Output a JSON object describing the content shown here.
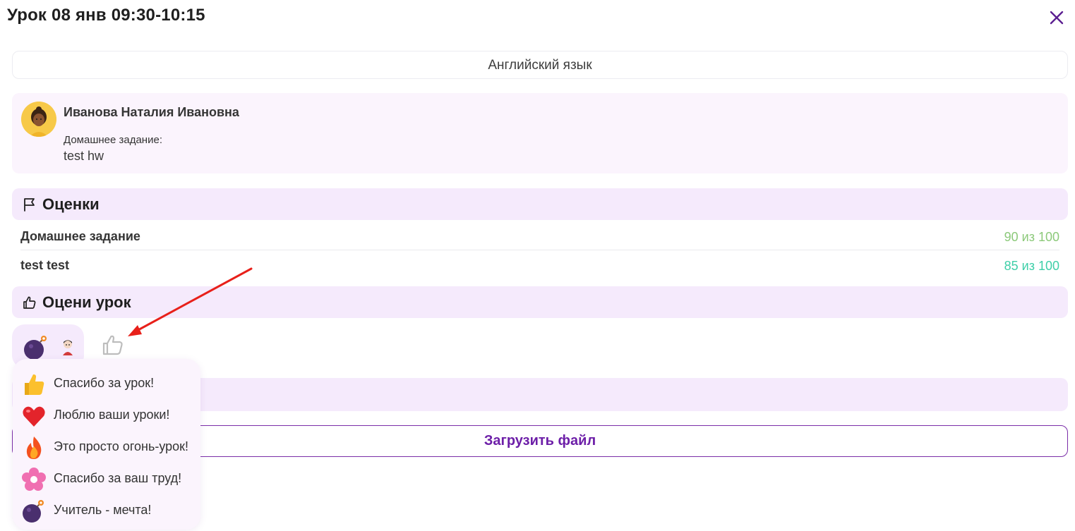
{
  "header": {
    "title": "Урок 08 янв 09:30-10:15",
    "close_icon": "close-icon"
  },
  "subject": "Английский язык",
  "teacher": {
    "name": "Иванова Наталия Ивановна",
    "homework_label": "Домашнее задание:",
    "homework_text": "test hw"
  },
  "grades_section": {
    "title": "Оценки",
    "icon": "flag-icon",
    "items": [
      {
        "name": "Домашнее задание",
        "value": "90 из 100",
        "color": "#8cc97a"
      },
      {
        "name": "test test",
        "value": "85 из 100",
        "color": "#3ecfa8"
      }
    ]
  },
  "rate_section": {
    "title": "Оцени урок",
    "icon": "thumbs-up-icon"
  },
  "reactions_popup": {
    "items": [
      {
        "label": "Спасибо за урок!",
        "icon": "thumbs-up-emoji"
      },
      {
        "label": "Люблю ваши уроки!",
        "icon": "heart-emoji"
      },
      {
        "label": "Это просто огонь-урок!",
        "icon": "fire-emoji"
      },
      {
        "label": "Спасибо за ваш труд!",
        "icon": "flower-emoji"
      },
      {
        "label": "Учитель - мечта!",
        "icon": "bomb-emoji"
      }
    ]
  },
  "upload_button": "Загрузить файл",
  "colors": {
    "accent": "#6d1fa8",
    "panel": "#f5eafc",
    "card": "#fbf4fd",
    "annotation_arrow": "#e8201a"
  }
}
